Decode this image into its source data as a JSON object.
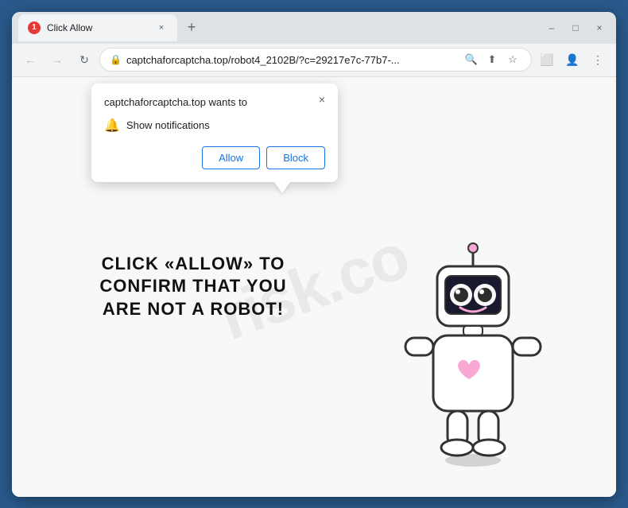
{
  "browser": {
    "title": "Click Allow",
    "tab_close": "×",
    "new_tab": "+",
    "favicon_text": "1",
    "window_controls": {
      "minimize": "–",
      "maximize": "□",
      "close": "×"
    }
  },
  "address_bar": {
    "url_display": "captchaforcaptcha.top/robot4_2102B/?c=29217e7c-77b7-...",
    "full_url": "captchaforcaptcha.top/robot4_2102B/?c=29217e7c-77b7-...",
    "lock_icon": "🔒"
  },
  "nav": {
    "back": "←",
    "forward": "→",
    "refresh": "↻"
  },
  "notification": {
    "title": "captchaforcaptcha.top wants to",
    "close_icon": "×",
    "bell_icon": "🔔",
    "show_notifications": "Show notifications",
    "allow_label": "Allow",
    "block_label": "Block"
  },
  "page": {
    "captcha_message_line1": "CLICK «ALLOW» TO CONFIRM THAT YOU",
    "captcha_message_line2": "ARE NOT A ROBOT!",
    "watermark": "risk.co"
  }
}
